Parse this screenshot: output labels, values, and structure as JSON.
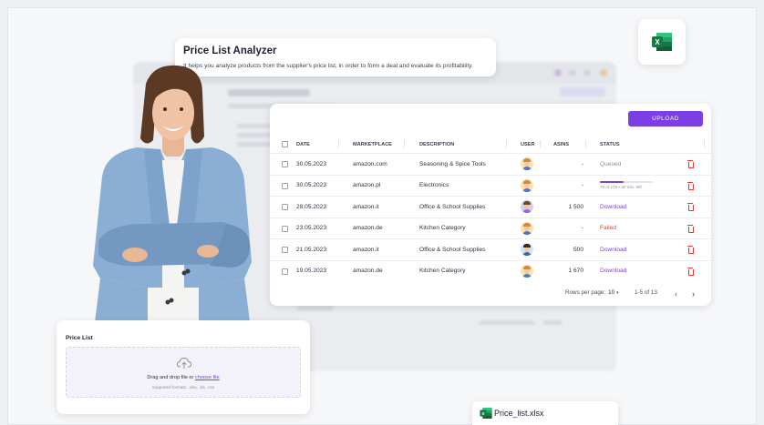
{
  "tooltip": {
    "title": "Price List Analyzer",
    "text": "It helps you analyze products from the supplier's price list, in order to form a deal and evaluate its profitability."
  },
  "table": {
    "upload_label": "UPLOAD",
    "columns": [
      "DATE",
      "MARKETPLACE",
      "DESCRIPTION",
      "USER",
      "ASINS",
      "STATUS"
    ],
    "rows": [
      {
        "date": "30.05.2023",
        "marketplace": "amazon.com",
        "description": "Seasoning & Spice Tools",
        "avatar": "user-avatar-1",
        "asins": "-",
        "status": "Queued",
        "status_kind": "queued"
      },
      {
        "date": "30.05.2023",
        "marketplace": "amazon.pl",
        "description": "Electronics",
        "avatar": "user-avatar-1",
        "asins": "-",
        "status": "78 of 179 • 30 min. left",
        "status_kind": "progress",
        "progress": 0.44
      },
      {
        "date": "28.05.2023",
        "marketplace": "amazon.it",
        "description": "Office & School Supplies",
        "avatar": "user-avatar-2",
        "asins": "1 500",
        "status": "Download",
        "status_kind": "download"
      },
      {
        "date": "23.05.2023",
        "marketplace": "amazon.de",
        "description": "Kitchen Category",
        "avatar": "user-avatar-1",
        "asins": "-",
        "status": "Failed",
        "status_kind": "failed"
      },
      {
        "date": "21.05.2023",
        "marketplace": "amazon.it",
        "description": "Office & School Supplies",
        "avatar": "user-avatar-3",
        "asins": "500",
        "status": "Download",
        "status_kind": "download"
      },
      {
        "date": "19.05.2023",
        "marketplace": "amazon.de",
        "description": "Kitchen Category",
        "avatar": "user-avatar-1",
        "asins": "1 670",
        "status": "Download",
        "status_kind": "download"
      }
    ],
    "pager": {
      "rows_per_page_label": "Rows per page:",
      "rows_per_page_value": "10",
      "range": "1-5 of 13"
    }
  },
  "price_list": {
    "label": "Price List",
    "drop_text": "Drag and drop file or",
    "drop_link": "choose file",
    "formats": "Supported formats: .xlsx, .xls, .csv"
  },
  "file": {
    "name": "Price_list.xlsx"
  },
  "colors": {
    "accent": "#7b3fe4",
    "danger": "#e53935",
    "excel": "#21a366"
  },
  "icons": [
    "excel-icon",
    "upload-cloud-icon",
    "trash-icon",
    "chevron-left-icon",
    "chevron-right-icon",
    "chevron-down-icon"
  ]
}
